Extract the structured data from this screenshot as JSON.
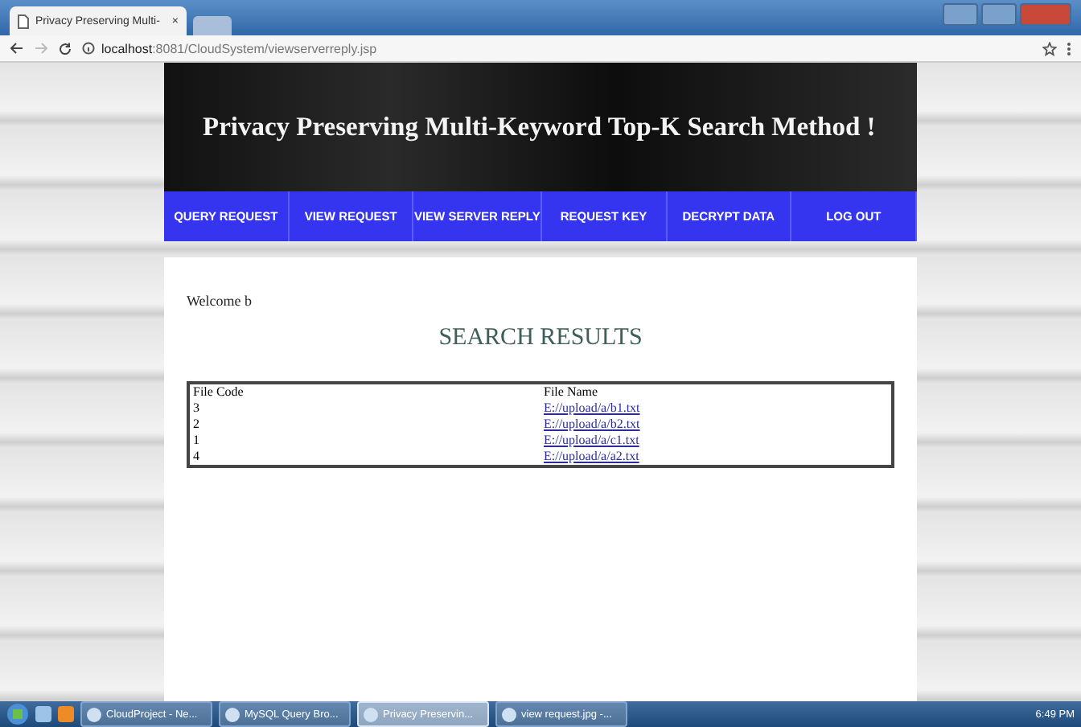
{
  "browser": {
    "tab_title": "Privacy Preserving Multi-",
    "tab_close": "×",
    "url_host": "localhost",
    "url_rest": ":8081/CloudSystem/viewserverreply.jsp"
  },
  "header": {
    "title": "Privacy Preserving Multi-Keyword Top-K Search Method !"
  },
  "nav": [
    {
      "label": "QUERY REQUEST"
    },
    {
      "label": "VIEW REQUEST"
    },
    {
      "label": "VIEW SERVER REPLY"
    },
    {
      "label": "REQUEST KEY"
    },
    {
      "label": "DECRYPT DATA"
    },
    {
      "label": "LOG OUT"
    }
  ],
  "welcome": "Welcome b",
  "heading": "SEARCH RESULTS",
  "table": {
    "columns": [
      "File Code",
      "File Name"
    ],
    "rows": [
      {
        "code": "3",
        "name": "E://upload/a/b1.txt"
      },
      {
        "code": "2",
        "name": "E://upload/a/b2.txt"
      },
      {
        "code": "1",
        "name": "E://upload/a/c1.txt"
      },
      {
        "code": "4",
        "name": "E://upload/a/a2.txt"
      }
    ]
  },
  "taskbar": {
    "items": [
      {
        "label": "CloudProject - Ne...",
        "selected": false
      },
      {
        "label": "MySQL Query Bro...",
        "selected": false
      },
      {
        "label": "Privacy Preservin...",
        "selected": true
      },
      {
        "label": "view request.jpg -...",
        "selected": false
      }
    ],
    "clock": "6:49 PM"
  }
}
